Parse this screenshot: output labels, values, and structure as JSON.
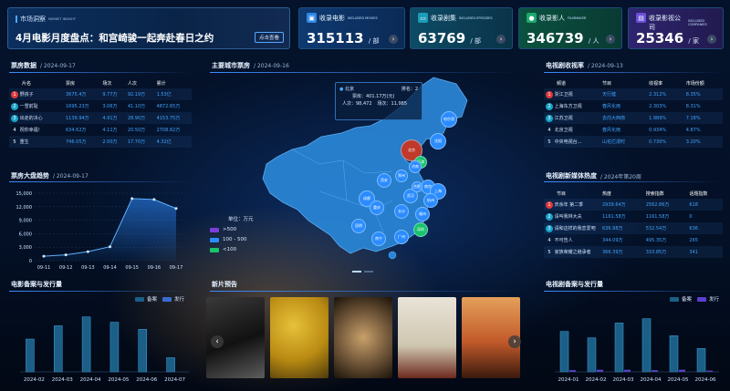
{
  "banner": {
    "tag": "市场洞察",
    "tag_en": "MARKET INSIGHT",
    "headline": "4月电影月度盘点：和宫崎骏一起奔赴春日之约",
    "button": "点击查看"
  },
  "stats": [
    {
      "label": "收录电影",
      "label_en": "INCLUDED MOVIES",
      "value": "315113",
      "unit": "/ 部",
      "color": "#1c5ea8",
      "icon": "film-icon"
    },
    {
      "label": "收录剧集",
      "label_en": "INCLUDED EPISODES",
      "value": "63769",
      "unit": "/ 部",
      "color": "#17607a",
      "icon": "tv-icon"
    },
    {
      "label": "收录影人",
      "label_en": "FILMMAKER",
      "value": "346739",
      "unit": "/ 人",
      "color": "#0f6a4a",
      "icon": "person-icon"
    },
    {
      "label": "收录影视公司",
      "label_en": "INCLUDED COMPANIES",
      "value": "25346",
      "unit": "/ 家",
      "color": "#3d2f8a",
      "icon": "company-icon"
    }
  ],
  "boxoffice": {
    "title": "票房数据",
    "date": "/ 2024-09-17",
    "headers": [
      "片名",
      "票房",
      "场次",
      "人次",
      "累计"
    ],
    "rows": [
      {
        "rank": "1",
        "name": "野孩子",
        "gross": "3675.4万",
        "shows": "9.77万",
        "viewers": "92.19万",
        "total": "1.53亿",
        "color": "#e03a3a"
      },
      {
        "rank": "2",
        "name": "一雪前耻",
        "gross": "1695.23万",
        "shows": "3.06万",
        "viewers": "41.10万",
        "total": "4872.65万",
        "color": "#1aa3c8"
      },
      {
        "rank": "3",
        "name": "出走的决心",
        "gross": "1139.94万",
        "shows": "4.91万",
        "viewers": "28.90万",
        "total": "4153.75万",
        "color": "#1aa3c8"
      },
      {
        "rank": "4",
        "name": "祝你幸福！",
        "gross": "634.62万",
        "shows": "4.11万",
        "viewers": "20.50万",
        "total": "2708.82万",
        "color": ""
      },
      {
        "rank": "5",
        "name": "重生",
        "gross": "746.05万",
        "shows": "2.00万",
        "viewers": "17.70万",
        "total": "4.32亿",
        "color": ""
      }
    ]
  },
  "trend": {
    "title": "票房大盘趋势",
    "date": "/ 2024-09-17",
    "chart_data": {
      "type": "area",
      "x": [
        "09-11",
        "09-12",
        "09-13",
        "09-14",
        "09-15",
        "09-16",
        "09-17"
      ],
      "values": [
        1000,
        1300,
        2000,
        3100,
        13800,
        13600,
        11600
      ],
      "yticks": [
        "0",
        "3,000",
        "6,000",
        "9,000",
        "12,000",
        "15,000"
      ],
      "ylim": [
        0,
        15000
      ]
    }
  },
  "citymap": {
    "title": "主要城市票房",
    "date": "/ 2024-09-16",
    "tooltip": {
      "city": "北京",
      "rank_label": "排名：2",
      "gross": "票房：401.17万(元)",
      "viewers": "人次：98,472",
      "shows": "场次：11,985"
    },
    "cities": [
      "哈尔滨",
      "沈阳",
      "北京",
      "天津",
      "西安",
      "郑州",
      "济南",
      "南京",
      "上海",
      "杭州",
      "武汉",
      "成都",
      "重庆",
      "长沙",
      "昆明",
      "南宁",
      "广州",
      "深圳",
      "福州",
      "合肥"
    ],
    "legend_title": "单位：万元",
    "legend": [
      {
        "label": ">500",
        "color": "#7b3fd8"
      },
      {
        "label": "100 - 500",
        "color": "#2b8cff"
      },
      {
        "label": "<100",
        "color": "#19c46b"
      }
    ]
  },
  "tvratings": {
    "title": "电视剧收视率",
    "date": "/ 2024-09-13",
    "headers": [
      "频道",
      "节目",
      "收视率",
      "市场份额"
    ],
    "rows": [
      {
        "rank": "1",
        "channel": "浙江卫视",
        "show": "天行健",
        "rating": "2.312%",
        "share": "8.35%",
        "color": "#e03a3a"
      },
      {
        "rank": "2",
        "channel": "上海东方卫视",
        "show": "春风化雨",
        "rating": "2.303%",
        "share": "8.31%",
        "color": "#1aa3c8"
      },
      {
        "rank": "3",
        "channel": "江苏卫视",
        "show": "去向大西南",
        "rating": "1.989%",
        "share": "7.18%",
        "color": "#1aa3c8"
      },
      {
        "rank": "4",
        "channel": "北京卫视",
        "show": "春风化雨",
        "rating": "0.934%",
        "share": "4.87%",
        "color": ""
      },
      {
        "rank": "5",
        "channel": "中央电视台...",
        "show": "山花烂漫时",
        "rating": "0.730%",
        "share": "3.20%",
        "color": ""
      }
    ]
  },
  "newmedia": {
    "title": "电视剧新媒体热度",
    "date": "/ 2024年第20周",
    "headers": [
      "节目",
      "热度",
      "搜索指数",
      "话题指数"
    ],
    "rows": [
      {
        "rank": "1",
        "show": "庆余年 第二季",
        "heat": "2939.64万",
        "search": "2562.86万",
        "topic": "618",
        "color": "#e03a3a"
      },
      {
        "rank": "2",
        "show": "请叫我林大夫",
        "heat": "1161.58万",
        "search": "1161.58万",
        "topic": "0",
        "color": "#1aa3c8"
      },
      {
        "rank": "3",
        "show": "请和这样的我恋爱吧",
        "heat": "636.98万",
        "search": "532.54万",
        "topic": "636",
        "color": "#1aa3c8"
      },
      {
        "rank": "4",
        "show": "不可告人",
        "heat": "344.09万",
        "search": "495.35万",
        "topic": "265",
        "color": ""
      },
      {
        "rank": "5",
        "show": "家族荣耀之继承者",
        "heat": "366.39万",
        "search": "333.85万",
        "topic": "341",
        "color": ""
      }
    ]
  },
  "filmfiling": {
    "title": "电影备案与发行量",
    "legend": [
      "备案",
      "发行"
    ],
    "chart_data": {
      "type": "bar",
      "categories": [
        "2024-02",
        "2024-03",
        "2024-04",
        "2024-05",
        "2024-06",
        "2024-07"
      ],
      "series": [
        {
          "name": "备案",
          "values": [
            185,
            260,
            310,
            280,
            240,
            80
          ]
        },
        {
          "name": "发行",
          "values": [
            0,
            0,
            0,
            0,
            0,
            0
          ]
        }
      ],
      "ylim": [
        0,
        360
      ]
    }
  },
  "upcoming": {
    "title": "新片预告"
  },
  "tvfiling": {
    "title": "电视剧备案与发行量",
    "legend": [
      "备案",
      "发行"
    ],
    "chart_data": {
      "type": "bar",
      "categories": [
        "2024-01",
        "2024-02",
        "2024-03",
        "2024-04",
        "2024-05",
        "2024-06"
      ],
      "series": [
        {
          "name": "备案",
          "values": [
            95,
            80,
            115,
            125,
            85,
            55
          ]
        },
        {
          "name": "发行",
          "values": [
            4,
            5,
            5,
            4,
            5,
            3
          ]
        }
      ],
      "ylim": [
        0,
        150
      ]
    }
  }
}
